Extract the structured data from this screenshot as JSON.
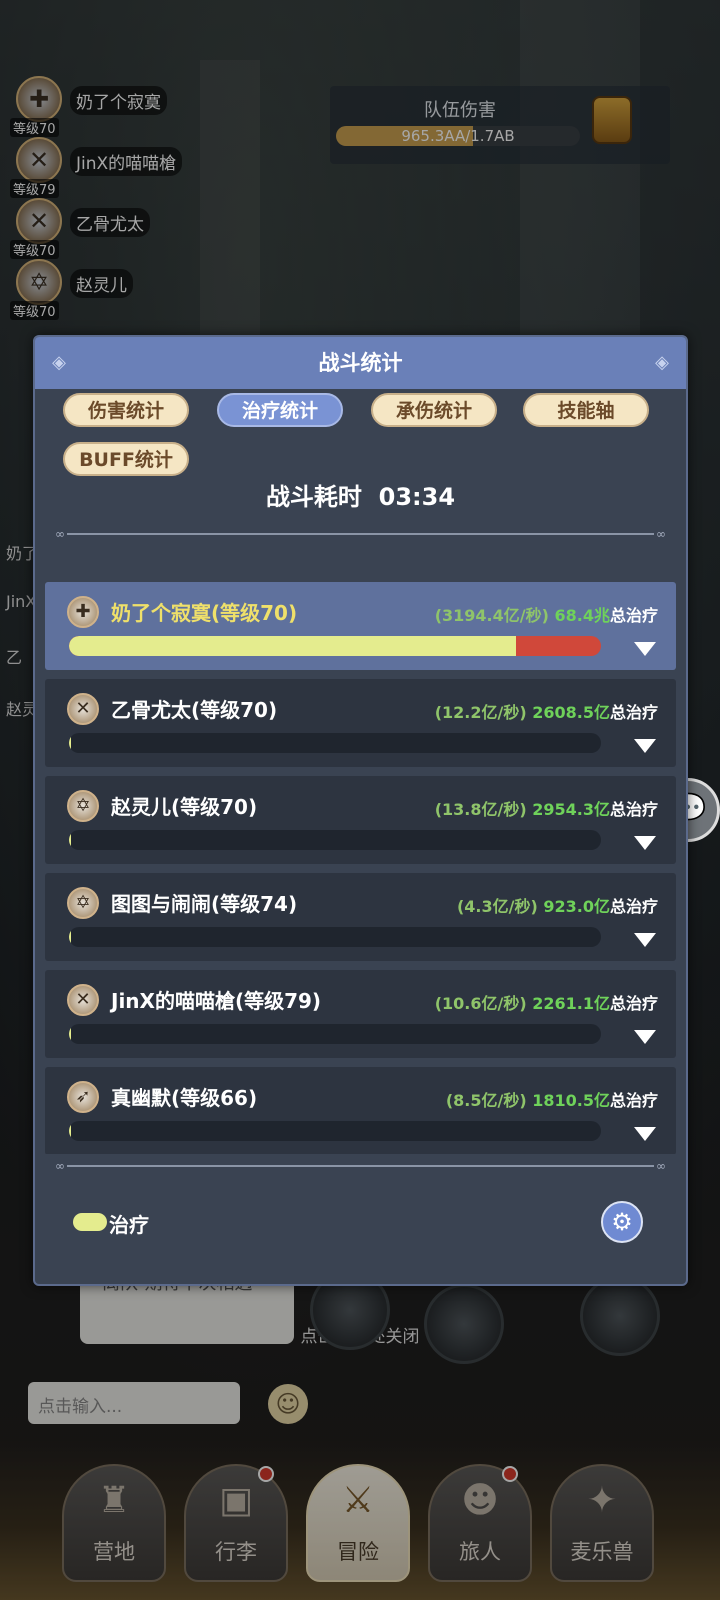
{
  "background": {
    "party": [
      {
        "name": "奶了个寂寞",
        "level": "等级70",
        "icon": "heal-class-icon"
      },
      {
        "name": "JinX的喵喵槍",
        "level": "等级79",
        "icon": "sword-class-icon"
      },
      {
        "name": "乙骨尤太",
        "level": "等级70",
        "icon": "sword-class-icon"
      },
      {
        "name": "赵灵儿",
        "level": "等级70",
        "icon": "star-class-icon"
      }
    ],
    "team_damage": {
      "title": "队伍伤害",
      "value": "965.3AA/1.7AB",
      "progress_fraction": 0.56
    },
    "side_names": [
      "奶了",
      "JinX",
      "乙",
      "赵灵"
    ],
    "chat_bubble": "离队-期待下次相遇~",
    "close_hint": "点击空白处关闭",
    "chat_input_placeholder": "点击输入...",
    "nav": [
      {
        "label": "营地",
        "icon": "castle-icon",
        "badge": false
      },
      {
        "label": "行李",
        "icon": "chest-icon",
        "badge": true
      },
      {
        "label": "冒险",
        "icon": "crossed-swords-icon",
        "badge": false,
        "active": true
      },
      {
        "label": "旅人",
        "icon": "traveler-icon",
        "badge": true
      },
      {
        "label": "麦乐兽",
        "icon": "pet-icon",
        "badge": false
      }
    ]
  },
  "modal": {
    "title": "战斗统计",
    "tabs": [
      {
        "label": "伤害统计",
        "active": false
      },
      {
        "label": "治疗统计",
        "active": true
      },
      {
        "label": "承伤统计",
        "active": false
      },
      {
        "label": "技能轴",
        "active": false
      },
      {
        "label": "BUFF统计",
        "active": false
      }
    ],
    "duration_label": "战斗耗时",
    "duration_value": "03:34",
    "rows": [
      {
        "name": "奶了个寂寞(等级70)",
        "rate": "(3194.4亿/秒)",
        "total": "68.4兆",
        "suffix": "总治疗",
        "fill_fraction": 0.84,
        "selected": true,
        "icon": "heal-class-icon"
      },
      {
        "name": "乙骨尤太(等级70)",
        "rate": "(12.2亿/秒)",
        "total": "2608.5亿",
        "suffix": "总治疗",
        "fill_fraction": 0.004,
        "selected": false,
        "icon": "sword-class-icon"
      },
      {
        "name": "赵灵儿(等级70)",
        "rate": "(13.8亿/秒)",
        "total": "2954.3亿",
        "suffix": "总治疗",
        "fill_fraction": 0.004,
        "selected": false,
        "icon": "star-class-icon"
      },
      {
        "name": "图图与闹闹(等级74)",
        "rate": "(4.3亿/秒)",
        "total": "923.0亿",
        "suffix": "总治疗",
        "fill_fraction": 0.002,
        "selected": false,
        "icon": "star-class-icon"
      },
      {
        "name": "JinX的喵喵槍(等级79)",
        "rate": "(10.6亿/秒)",
        "total": "2261.1亿",
        "suffix": "总治疗",
        "fill_fraction": 0.004,
        "selected": false,
        "icon": "sword-class-icon"
      },
      {
        "name": "真幽默(等级66)",
        "rate": "(8.5亿/秒)",
        "total": "1810.5亿",
        "suffix": "总治疗",
        "fill_fraction": 0.003,
        "selected": false,
        "icon": "bow-class-icon"
      }
    ],
    "legend": {
      "label": "治疗",
      "color": "#e4ec8e"
    },
    "settings_icon": "gear-icon"
  }
}
